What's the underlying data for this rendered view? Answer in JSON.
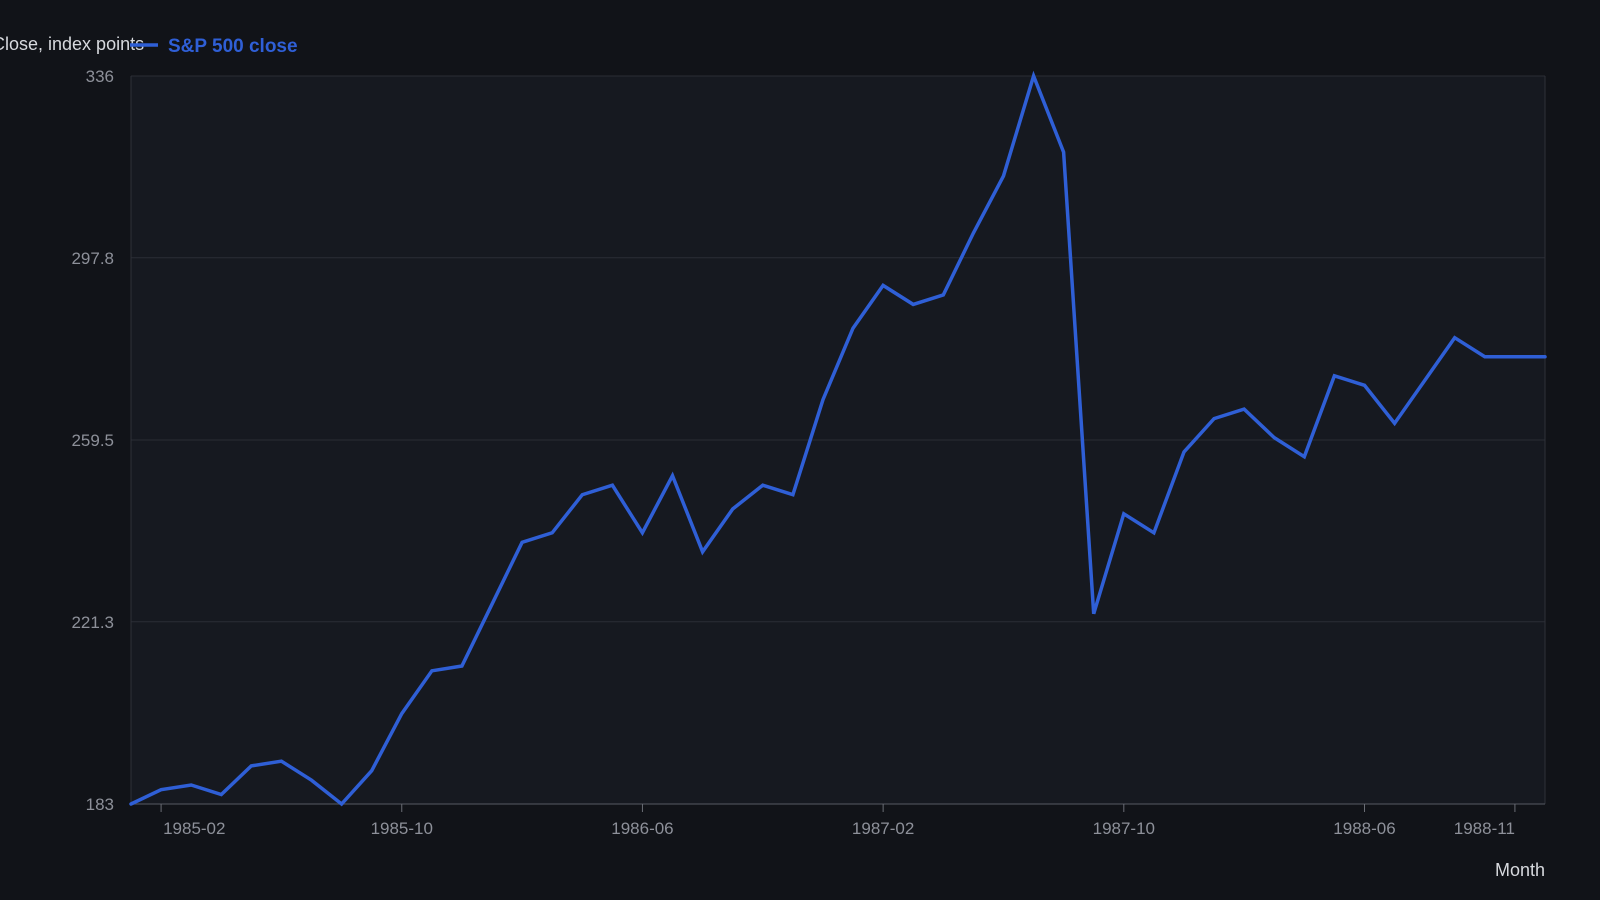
{
  "chart_data": {
    "type": "line",
    "ylabel": "Close, index points",
    "xlabel": "Month",
    "ylim": [
      183,
      336
    ],
    "y_ticks": [
      "183",
      "221.3",
      "259.5",
      "297.8",
      "336"
    ],
    "x_ticks": [
      "1985-02",
      "1985-10",
      "1986-06",
      "1987-02",
      "1987-10",
      "1988-06",
      "1988-11"
    ],
    "grid": true,
    "legend_position": "top-left",
    "colors": {
      "background": "#111318",
      "plot_background": "#161920",
      "line": "#2f5fd6",
      "grid": "#2a2d35"
    },
    "x": [
      "1985-01",
      "1985-02",
      "1985-03",
      "1985-04",
      "1985-05",
      "1985-06",
      "1985-07",
      "1985-08",
      "1985-09",
      "1985-10",
      "1985-11",
      "1985-12",
      "1986-01",
      "1986-02",
      "1986-03",
      "1986-04",
      "1986-05",
      "1986-06",
      "1986-07",
      "1986-08",
      "1986-09",
      "1986-10",
      "1986-11",
      "1986-12",
      "1987-01",
      "1987-02",
      "1987-03",
      "1987-04",
      "1987-05",
      "1987-06",
      "1987-07",
      "1987-08",
      "1987-09",
      "1987-10",
      "1987-11",
      "1987-12",
      "1988-01",
      "1988-02",
      "1988-03",
      "1988-04",
      "1988-05",
      "1988-06",
      "1988-07",
      "1988-08",
      "1988-09",
      "1988-10",
      "1988-11",
      "1988-12"
    ],
    "series": [
      {
        "name": "S&P 500 close",
        "values": [
          183,
          186,
          187,
          185,
          191,
          192,
          188,
          183,
          190,
          202,
          211,
          212,
          225,
          238,
          240,
          248,
          250,
          240,
          252,
          236,
          245,
          250,
          248,
          268,
          283,
          292,
          288,
          290,
          303,
          315,
          336,
          320,
          223,
          244,
          240,
          257,
          264,
          266,
          260,
          256,
          273,
          271,
          263,
          272,
          281,
          277,
          277,
          277
        ]
      }
    ]
  }
}
